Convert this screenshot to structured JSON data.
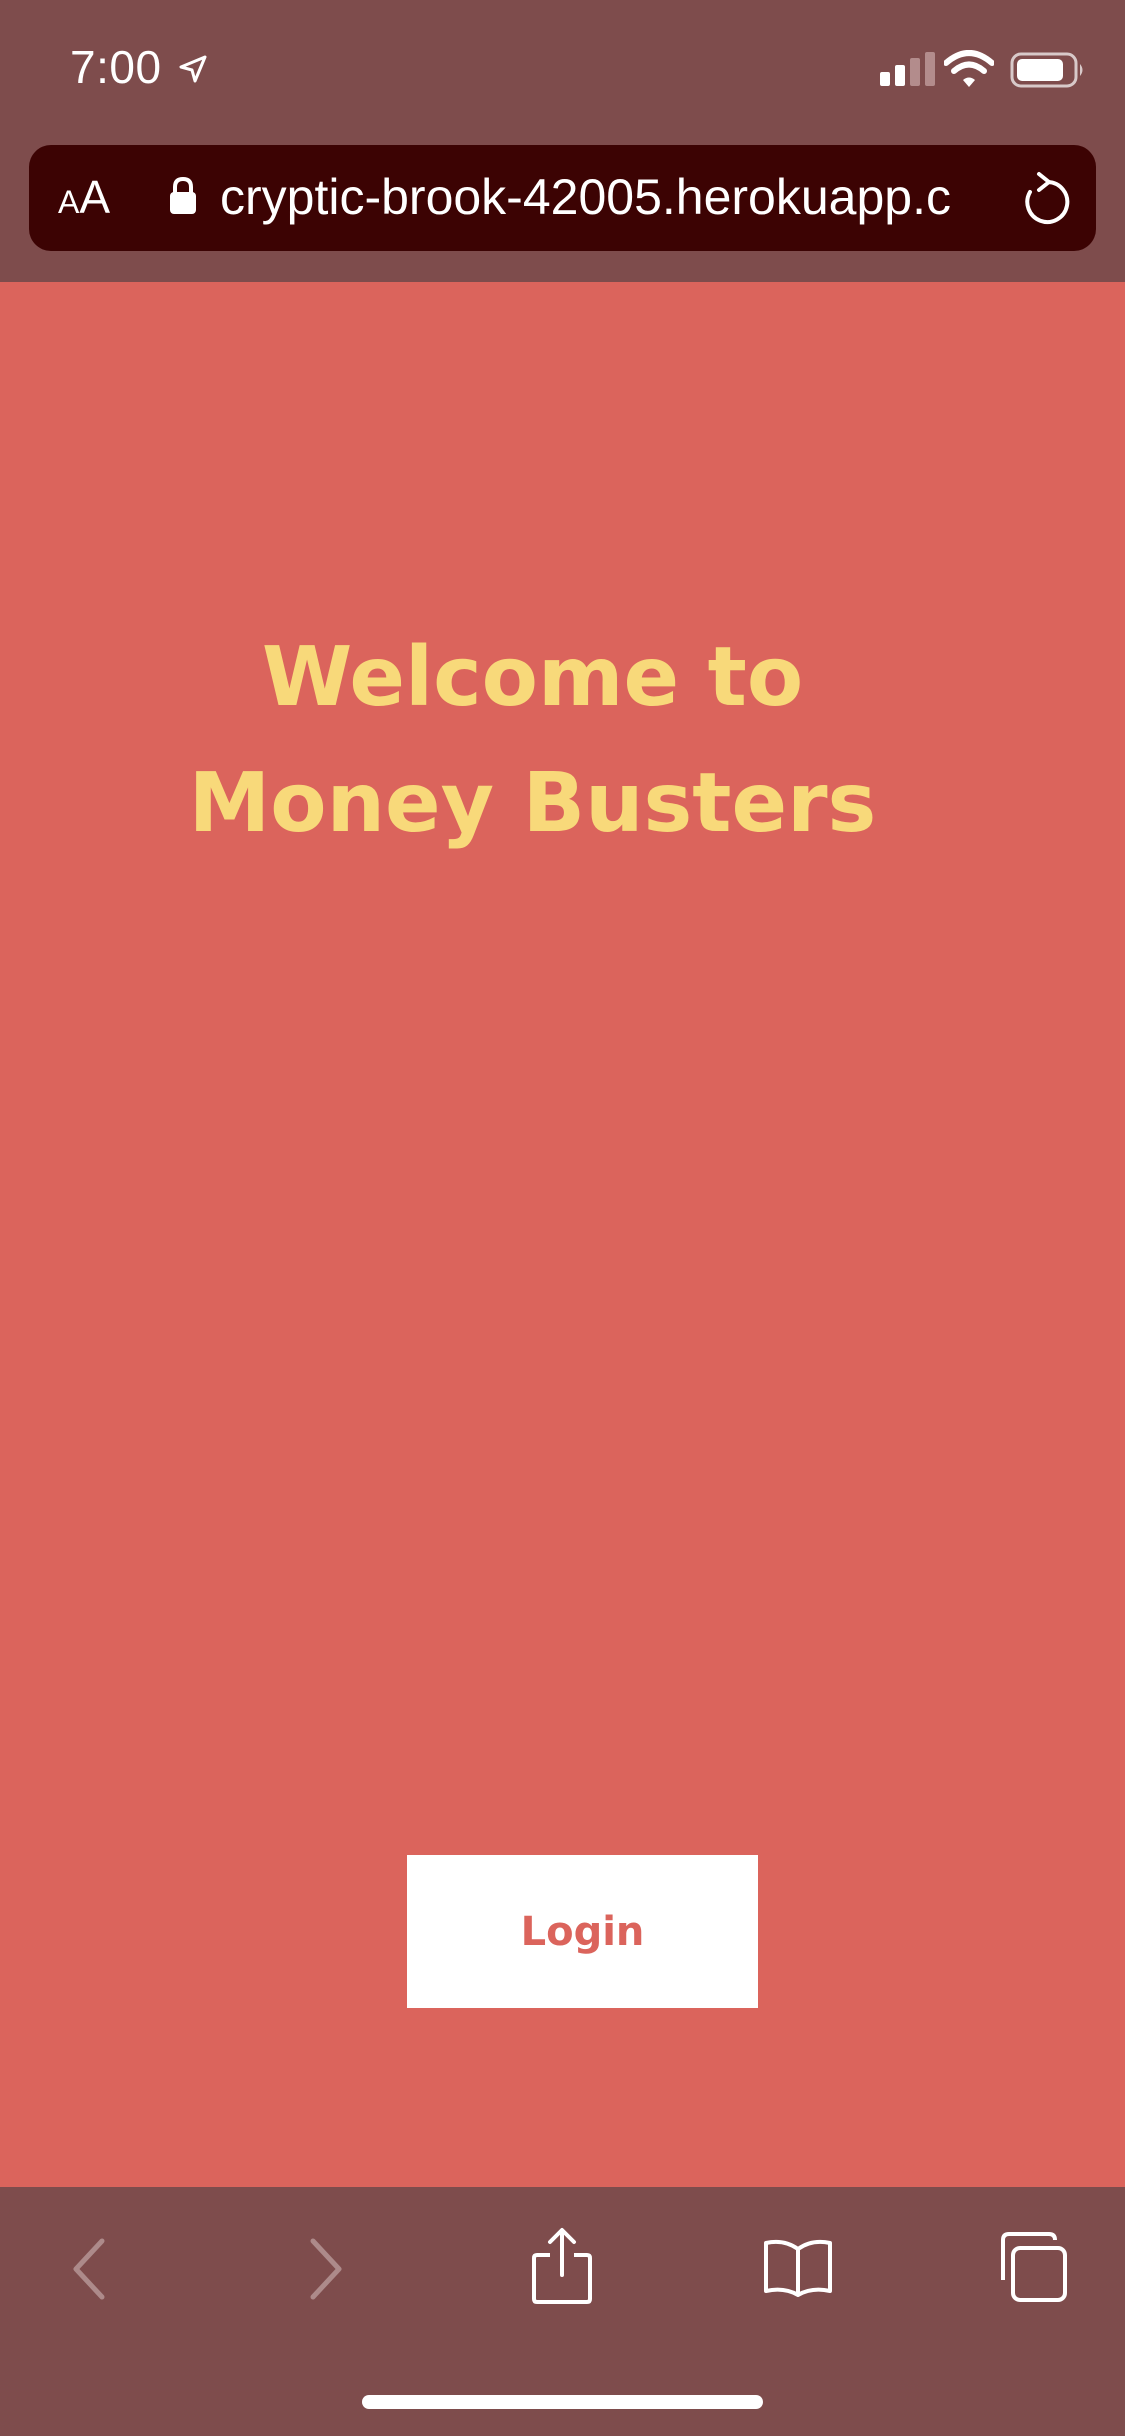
{
  "status_bar": {
    "time": "7:00",
    "icons": [
      "location-arrow-icon",
      "cellular-signal-icon",
      "wifi-icon",
      "battery-icon"
    ]
  },
  "browser": {
    "text_size_small": "A",
    "text_size_large": "A",
    "url": "cryptic-brook-42005.herokuapp.c",
    "icons": [
      "lock-icon",
      "reload-icon"
    ]
  },
  "main": {
    "welcome_line1": "Welcome to",
    "welcome_line2": "Money Busters",
    "login_label": "Login"
  },
  "toolbar": {
    "icons": [
      "back-icon",
      "forward-icon",
      "share-icon",
      "bookmarks-icon",
      "tabs-icon"
    ]
  },
  "colors": {
    "background": "#db645c",
    "chrome": "#7e4c4c",
    "url_bar": "#3c0303",
    "heading": "#f8d97a",
    "button": "#ffffff"
  }
}
